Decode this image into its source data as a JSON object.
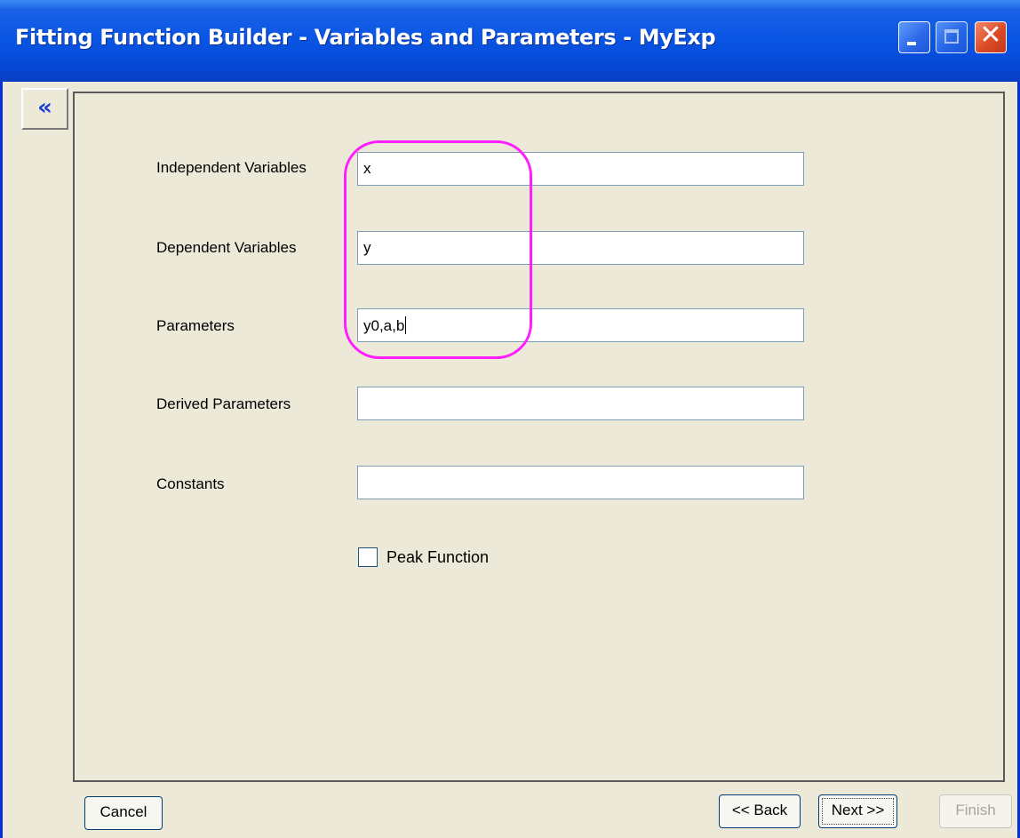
{
  "window": {
    "title": "Fitting Function Builder - Variables and Parameters - MyExp",
    "controls": {
      "minimize": "minimize",
      "maximize": "maximize",
      "close": "close"
    }
  },
  "nav": {
    "collapse_glyph": "«"
  },
  "form": {
    "fields": [
      {
        "label": "Independent Variables",
        "value": "x"
      },
      {
        "label": "Dependent Variables",
        "value": "y"
      },
      {
        "label": "Parameters",
        "value": "y0,a,b"
      },
      {
        "label": "Derived Parameters",
        "value": ""
      },
      {
        "label": "Constants",
        "value": ""
      }
    ],
    "peak_function": {
      "label": "Peak Function",
      "checked": false
    }
  },
  "buttons": {
    "cancel": "Cancel",
    "back": "<< Back",
    "next": "Next >>",
    "finish": "Finish"
  },
  "colors": {
    "titlebar": "#0a56e4",
    "highlight": "#ff1eff",
    "window_bg": "#ece9d8",
    "input_border": "#7f9db9"
  }
}
